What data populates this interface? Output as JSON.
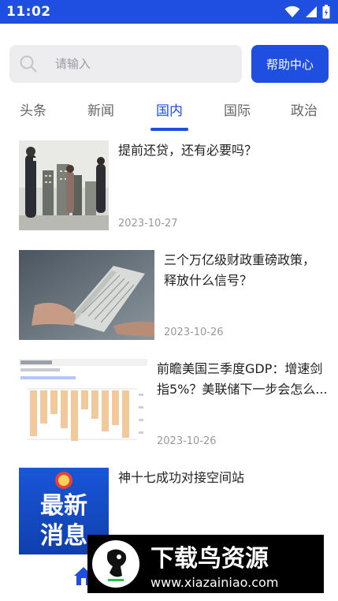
{
  "status_bar": {
    "time": "11:02"
  },
  "search": {
    "placeholder": "请输入",
    "help_label": "帮助中心"
  },
  "tabs": [
    {
      "label": "头条"
    },
    {
      "label": "新闻"
    },
    {
      "label": "国内"
    },
    {
      "label": "国际"
    },
    {
      "label": "政治"
    }
  ],
  "active_tab": "国内",
  "news": [
    {
      "title_line1": "提前还贷，还有必要吗？",
      "date": "2023-10-27"
    },
    {
      "title_line1": "三个万亿级财政重磅政策，",
      "title_line2": "释放什么信号？",
      "date": "2023-10-26"
    },
    {
      "title_line1": "前瞻美国三季度GDP：增速剑",
      "title_line2": "指5%？美联储下一步会怎么...",
      "date": "2023-10-26"
    },
    {
      "title_line1": "神十七成功对接空间站",
      "thumb_text_line1": "最新",
      "thumb_text_line2": "消息"
    }
  ],
  "watermark": {
    "brand": "下载鸟资源",
    "url": "www.xiazainiao.com"
  },
  "colors": {
    "accent": "#1f4fe0",
    "search_bg": "#ededf0",
    "date": "#999999"
  }
}
